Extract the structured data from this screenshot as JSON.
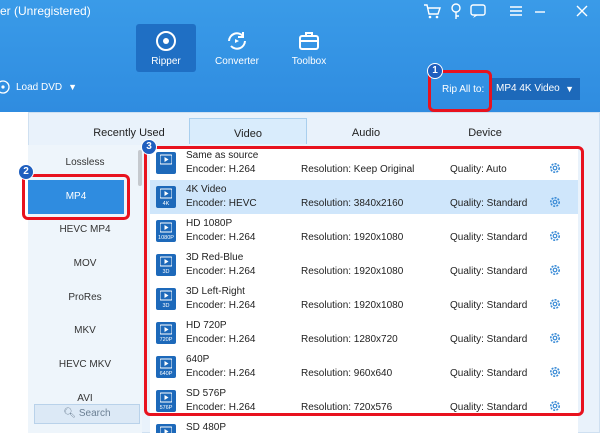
{
  "window": {
    "title": "er (Unregistered)",
    "icons": [
      "cart-icon",
      "key-icon",
      "chat-icon",
      "menu-icon",
      "minimize-icon",
      "close-icon"
    ]
  },
  "nav": {
    "tabs": [
      {
        "label": "Ripper",
        "icon": "disc-icon",
        "active": true
      },
      {
        "label": "Converter",
        "icon": "convert-icon",
        "active": false
      },
      {
        "label": "Toolbox",
        "icon": "toolbox-icon",
        "active": false
      }
    ]
  },
  "toolbar": {
    "load_dvd": "Load DVD",
    "rip_all_label": "Rip All to:",
    "rip_all_value": "MP4 4K Video"
  },
  "badges": [
    "1",
    "2",
    "3"
  ],
  "format_tabs": [
    "Recently Used",
    "Video",
    "Audio",
    "Device"
  ],
  "sidebar": {
    "items": [
      "Lossless",
      "MP4",
      "HEVC MP4",
      "MOV",
      "ProRes",
      "MKV",
      "HEVC MKV",
      "AVI"
    ],
    "selected": "MP4",
    "search_placeholder": "Search"
  },
  "profiles": [
    {
      "name": "Same as source",
      "encoder": "Encoder: H.264",
      "resolution": "Resolution: Keep Original",
      "quality": "Quality: Auto",
      "tag": ""
    },
    {
      "name": "4K Video",
      "encoder": "Encoder: HEVC",
      "resolution": "Resolution: 3840x2160",
      "quality": "Quality: Standard",
      "tag": "4K"
    },
    {
      "name": "HD 1080P",
      "encoder": "Encoder: H.264",
      "resolution": "Resolution: 1920x1080",
      "quality": "Quality: Standard",
      "tag": "1080P"
    },
    {
      "name": "3D Red-Blue",
      "encoder": "Encoder: H.264",
      "resolution": "Resolution: 1920x1080",
      "quality": "Quality: Standard",
      "tag": "3D"
    },
    {
      "name": "3D Left-Right",
      "encoder": "Encoder: H.264",
      "resolution": "Resolution: 1920x1080",
      "quality": "Quality: Standard",
      "tag": "3D"
    },
    {
      "name": "HD 720P",
      "encoder": "Encoder: H.264",
      "resolution": "Resolution: 1280x720",
      "quality": "Quality: Standard",
      "tag": "720P"
    },
    {
      "name": "640P",
      "encoder": "Encoder: H.264",
      "resolution": "Resolution: 960x640",
      "quality": "Quality: Standard",
      "tag": "640P"
    },
    {
      "name": "SD 576P",
      "encoder": "Encoder: H.264",
      "resolution": "Resolution: 720x576",
      "quality": "Quality: Standard",
      "tag": "576P"
    },
    {
      "name": "SD 480P",
      "encoder": "",
      "resolution": "",
      "quality": "",
      "tag": ""
    }
  ],
  "colors": {
    "accent": "#2f8ce0",
    "highlight_box": "#e8121e",
    "badge": "#1f5fbf",
    "row_selected": "#cfe6fb"
  }
}
